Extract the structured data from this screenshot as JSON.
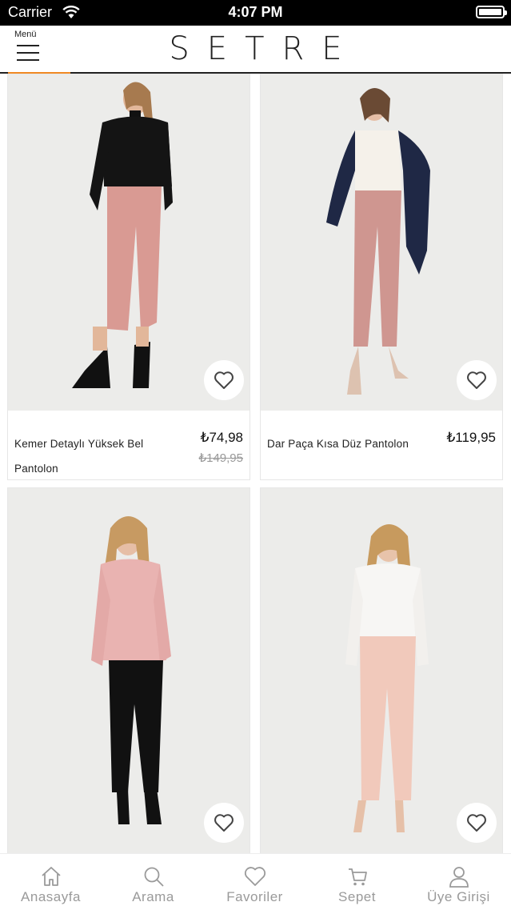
{
  "status_bar": {
    "carrier": "Carrier",
    "time": "4:07 PM"
  },
  "header": {
    "menu_label": "Menü",
    "brand": "SETRE"
  },
  "products": [
    {
      "name": "Kemer Detaylı Yüksek Bel Pantolon",
      "price": "₺74,98",
      "old_price": "₺149,95"
    },
    {
      "name": "Dar Paça Kısa Düz Pantolon",
      "price": "₺119,95",
      "old_price": ""
    },
    {
      "name": "",
      "price": "",
      "old_price": ""
    },
    {
      "name": "",
      "price": "",
      "old_price": ""
    }
  ],
  "tabs": [
    {
      "label": "Anasayfa",
      "icon": "home-icon"
    },
    {
      "label": "Arama",
      "icon": "search-icon"
    },
    {
      "label": "Favoriler",
      "icon": "heart-icon"
    },
    {
      "label": "Sepet",
      "icon": "cart-icon"
    },
    {
      "label": "Üye Girişi",
      "icon": "user-icon"
    }
  ],
  "colors": {
    "accent": "#f08a24",
    "tab_text": "#9a9a9a",
    "image_bg": "#ececea"
  }
}
